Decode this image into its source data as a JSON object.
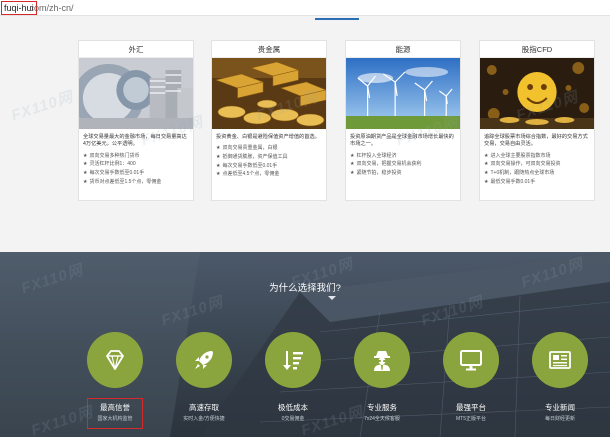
{
  "url": {
    "host": "fuqi-hui",
    "path": ".com/zh-cn/"
  },
  "cards": [
    {
      "title": "外汇",
      "desc": "全球交易量最大的金融市场，每日交易量高达4万亿美元，公平透明。",
      "items": [
        "双向交易多种热门货币",
        "灵活杠杆比例1：400",
        "每次交易手数低至0.01手",
        "货币对点差低至1.5个点，零佣金"
      ]
    },
    {
      "title": "贵金属",
      "desc": "投资黄金、白银是避险保值资产增值的首选。",
      "items": [
        "双向交易贵重金属，白银",
        "抵御通货膨胀，资产保值工具",
        "每次交易手数低至0.01手",
        "点差低至4.5个点，零佣金"
      ]
    },
    {
      "title": "能源",
      "desc": "投资原油期货产品是全球金融市场增长最快的市场之一。",
      "items": [
        "杠杆投入全球经济",
        "双向交易，把握交易机会获利",
        "紧随节拍，稳步投资"
      ]
    },
    {
      "title": "股指CFD",
      "desc": "追踪全球股票市场综合指数，最好的交易方式交易，交易自由灵活。",
      "items": [
        "进入全球主要股票指数市场",
        "双向交易操作，可双向交易投资",
        "T+0机制，跟随热点全球市场",
        "最低交易手数0.01手"
      ]
    }
  ],
  "section": {
    "title": "为什么选择我们?"
  },
  "features": [
    {
      "title": "最高信誉",
      "sub": "国家大机构监管",
      "icon": "diamond-icon"
    },
    {
      "title": "高速存取",
      "sub": "实时入金/方便快捷",
      "icon": "rocket-icon"
    },
    {
      "title": "极低成本",
      "sub": "0交易佣金",
      "icon": "sort-down-icon"
    },
    {
      "title": "专业服务",
      "sub": "7x24全天候客服",
      "icon": "agent-icon"
    },
    {
      "title": "最强平台",
      "sub": "MT5正版平台",
      "icon": "monitor-icon"
    },
    {
      "title": "专业新闻",
      "sub": "每日财经更新",
      "icon": "newspaper-icon"
    }
  ],
  "watermark": {
    "text": "FX110网"
  },
  "colors": {
    "feature_circle": "#8ba53e",
    "highlight": "#d62a2a",
    "accent": "#2a6fb5"
  }
}
